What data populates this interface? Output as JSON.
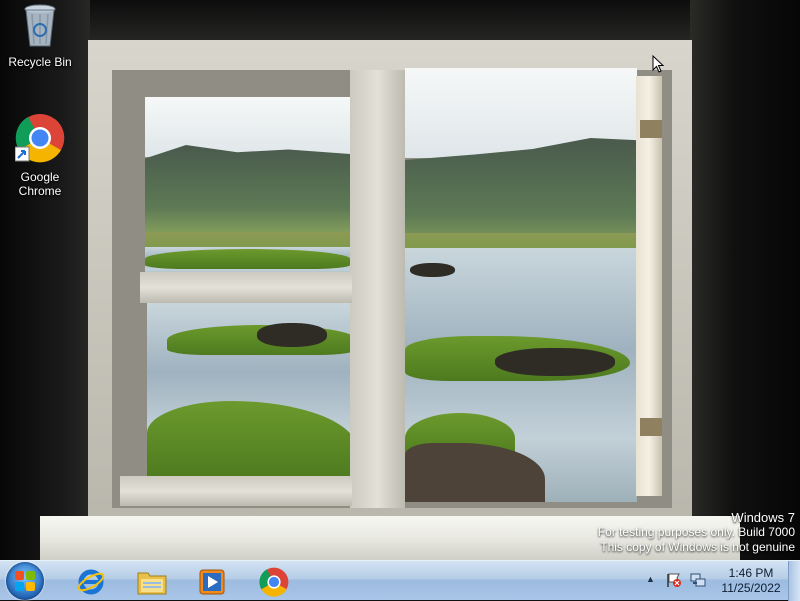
{
  "desktop": {
    "icons": [
      {
        "label": "Recycle Bin",
        "icon": "recycle-bin-icon"
      },
      {
        "label": "Google Chrome",
        "icon": "chrome-icon"
      }
    ]
  },
  "watermark": {
    "line1": "Windows 7",
    "line2": "For testing purposes only. Build 7000",
    "line3": "This copy of Windows is not genuine"
  },
  "taskbar": {
    "start": {
      "icon": "windows-start-icon"
    },
    "pinned": [
      {
        "name": "internet-explorer-icon"
      },
      {
        "name": "file-explorer-icon"
      },
      {
        "name": "media-player-icon"
      },
      {
        "name": "chrome-icon"
      }
    ],
    "tray": {
      "chevron": "▲",
      "icons": [
        "action-center-flag-icon",
        "network-icon"
      ]
    },
    "clock": {
      "time": "1:46 PM",
      "date": "11/25/2022"
    }
  },
  "colors": {
    "taskbar": "#b5cde6",
    "start_orb": "#2a6fc0"
  }
}
